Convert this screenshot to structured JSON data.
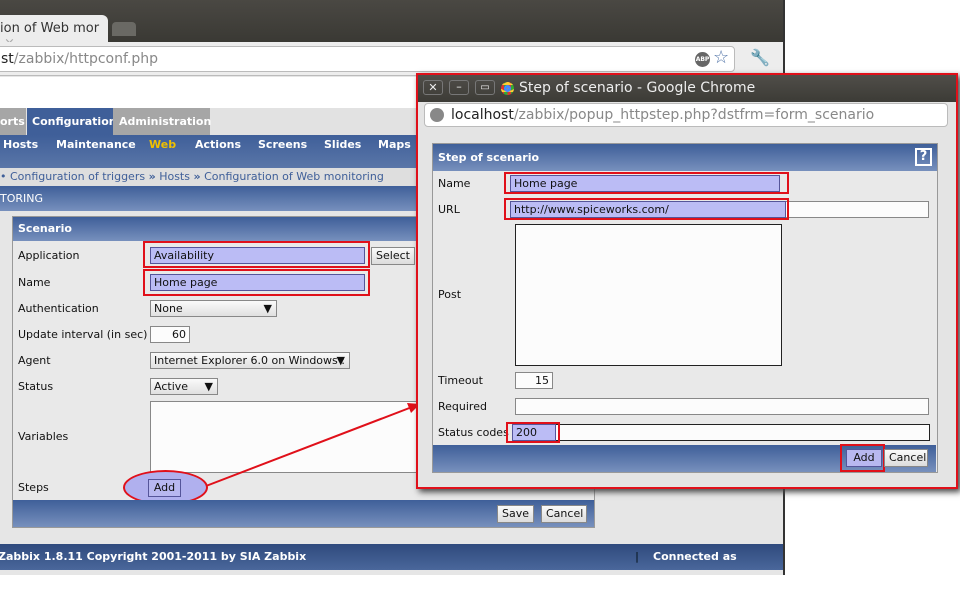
{
  "browser": {
    "tab_title": "ion of Web mor",
    "tab_close": "×",
    "url_host": "st",
    "url_path": "/zabbix/httpconf.php",
    "abp": "ABP"
  },
  "menu": {
    "tabs": [
      {
        "label": "orts"
      },
      {
        "label": "Configuration"
      },
      {
        "label": "Administration"
      }
    ],
    "sub": [
      {
        "label": "Hosts"
      },
      {
        "label": "Maintenance"
      },
      {
        "label": "Web"
      },
      {
        "label": "Actions"
      },
      {
        "label": "Screens"
      },
      {
        "label": "Slides"
      },
      {
        "label": "Maps"
      }
    ]
  },
  "breadcrumb": {
    "lead": "•",
    "items": [
      "Configuration of triggers",
      "Hosts",
      "Configuration of Web monitoring"
    ],
    "sep": "»"
  },
  "page_title": "TORING",
  "scenario": {
    "title": "Scenario",
    "application_label": "Application",
    "application_value": "Availability",
    "select_label": "Select",
    "name_label": "Name",
    "name_value": "Home page",
    "auth_label": "Authentication",
    "auth_value": "None",
    "interval_label": "Update interval (in sec)",
    "interval_value": "60",
    "agent_label": "Agent",
    "agent_value": "Internet Explorer 6.0 on Windows :",
    "status_label": "Status",
    "status_value": "Active",
    "variables_label": "Variables",
    "steps_label": "Steps",
    "add_label": "Add",
    "save_label": "Save",
    "cancel_label": "Cancel"
  },
  "footer": {
    "copyright": "Zabbix 1.8.11 Copyright 2001-2011 by SIA Zabbix",
    "sep": "|",
    "connected": "Connected as 'Admin'"
  },
  "popup": {
    "window_title": "Step of scenario - Google Chrome",
    "url_host": "localhost",
    "url_path": "/zabbix/popup_httpstep.php?dstfrm=form_scenario",
    "form_title": "Step of scenario",
    "help": "?",
    "name_label": "Name",
    "name_value": "Home page",
    "url_label": "URL",
    "url_value": "http://www.spiceworks.com/",
    "post_label": "Post",
    "timeout_label": "Timeout",
    "timeout_value": "15",
    "required_label": "Required",
    "required_value": "",
    "status_label": "Status codes",
    "status_value": "200",
    "add_label": "Add",
    "cancel_label": "Cancel"
  },
  "colors": {
    "highlight": "#e0101a",
    "accent": "#3f5f99",
    "active_menu": "#f0c000"
  }
}
